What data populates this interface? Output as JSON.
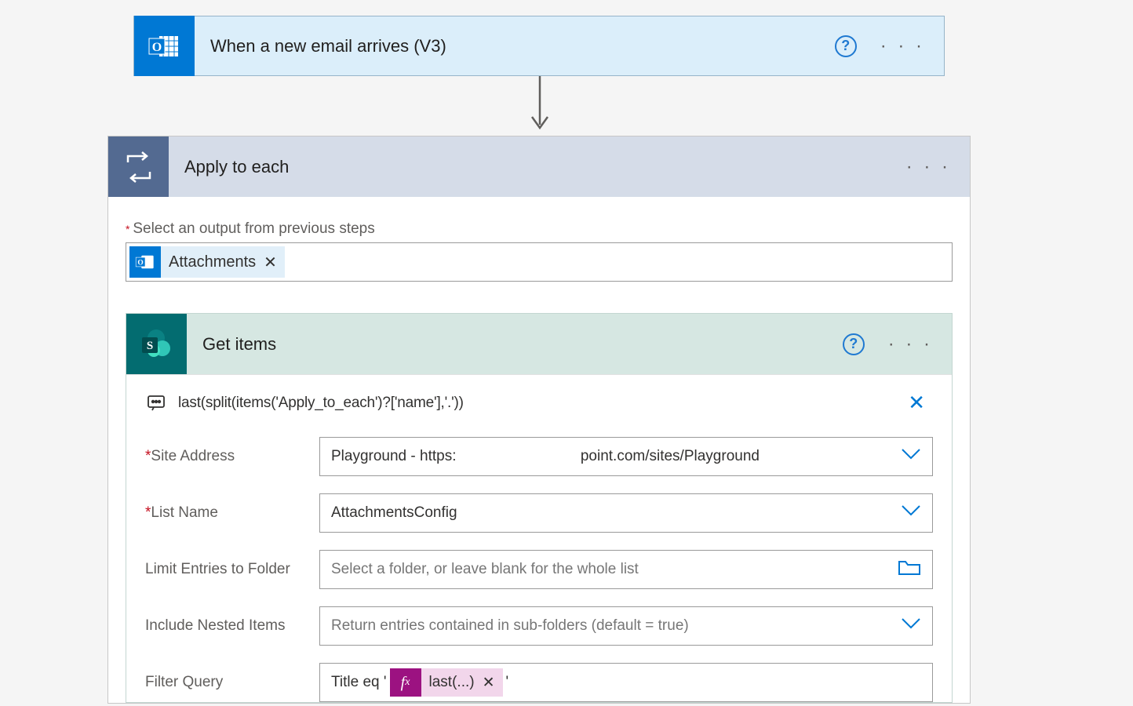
{
  "trigger": {
    "title": "When a new email arrives (V3)"
  },
  "applyToEach": {
    "title": "Apply to each",
    "outputLabel": "Select an output from previous steps",
    "token": "Attachments"
  },
  "getItems": {
    "title": "Get items",
    "peekExpression": "last(split(items('Apply_to_each')?['name'],'.'))",
    "params": {
      "siteAddress": {
        "label": "Site Address",
        "value": "Playground - https:                              point.com/sites/Playground"
      },
      "listName": {
        "label": "List Name",
        "value": "AttachmentsConfig"
      },
      "limitFolder": {
        "label": "Limit Entries to Folder",
        "placeholder": "Select a folder, or leave blank for the whole list"
      },
      "includeNested": {
        "label": "Include Nested Items",
        "placeholder": "Return entries contained in sub-folders (default = true)"
      },
      "filterQuery": {
        "label": "Filter Query",
        "prefix": "Title eq '",
        "tokenLabel": "last(...)",
        "suffix": "'"
      }
    }
  }
}
